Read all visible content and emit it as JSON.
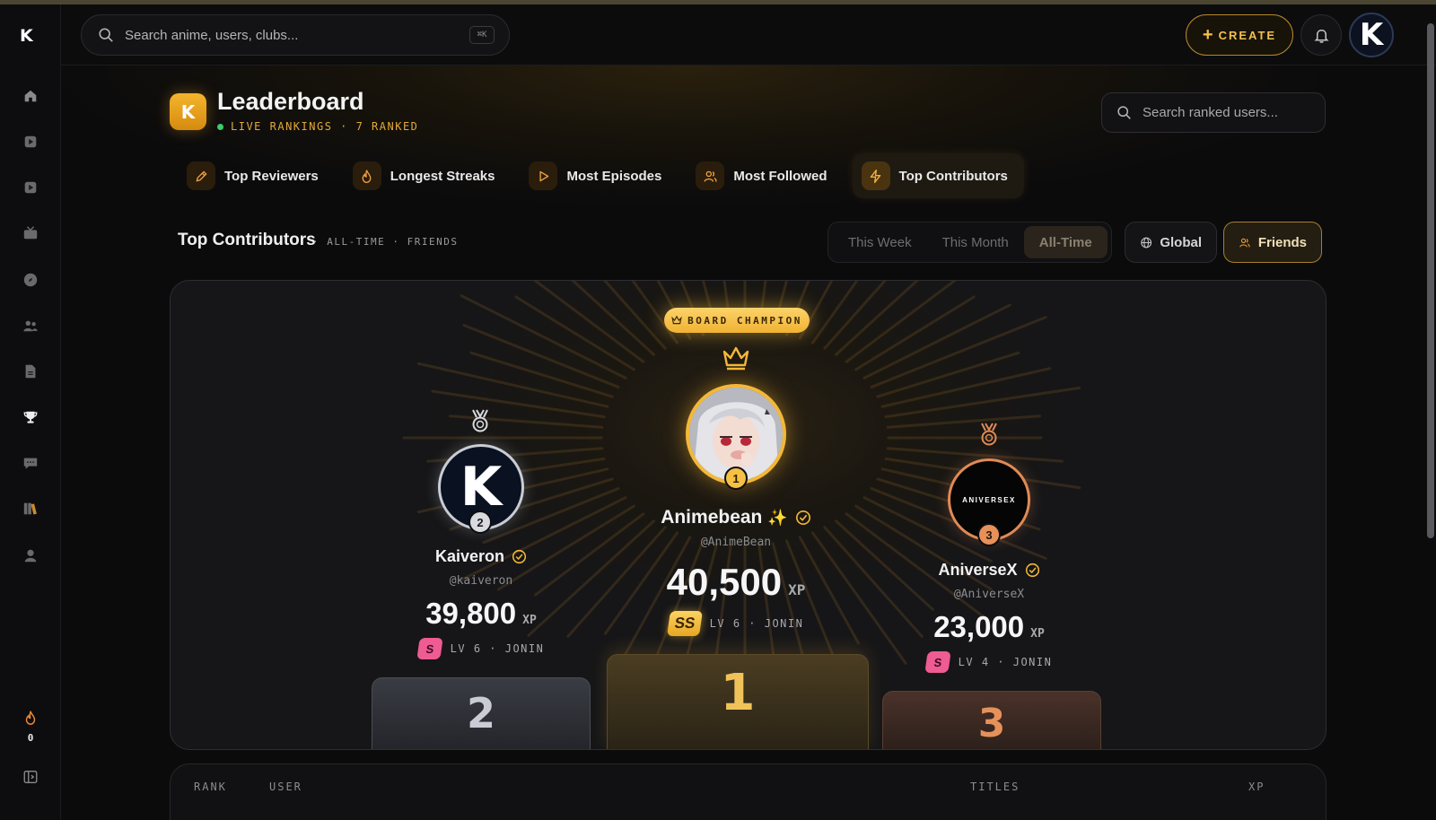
{
  "sidebar": {
    "logo": "K",
    "items": [
      "home-icon",
      "play-icon",
      "video-icon",
      "tv-icon",
      "compass-icon",
      "users-icon",
      "document-icon",
      "trophy-icon",
      "chat-icon",
      "library-icon",
      "profile-icon"
    ],
    "streak_count": "0"
  },
  "header": {
    "search_placeholder": "Search anime, users, clubs...",
    "shortcut": "⌘K",
    "create_label": "CREATE",
    "avatar_letter": "K"
  },
  "page": {
    "title": "Leaderboard",
    "subtitle": "LIVE RANKINGS · 7 RANKED",
    "icon_letter": "K",
    "ranked_search_placeholder": "Search ranked users..."
  },
  "tabs": [
    {
      "label": "Top Reviewers",
      "icon": "pencil-icon"
    },
    {
      "label": "Longest Streaks",
      "icon": "flame-icon"
    },
    {
      "label": "Most Episodes",
      "icon": "play-icon"
    },
    {
      "label": "Most Followed",
      "icon": "users-icon"
    },
    {
      "label": "Top Contributors",
      "icon": "bolt-icon",
      "active": true
    }
  ],
  "section": {
    "title": "Top Contributors",
    "meta": "· ALL-TIME · FRIENDS",
    "periods": [
      "This Week",
      "This Month",
      "All-Time"
    ],
    "active_period": "All-Time",
    "scopes": [
      "Global",
      "Friends"
    ],
    "active_scope": "Friends"
  },
  "podium": {
    "champion_label": "BOARD CHAMPION",
    "first": {
      "rank": "1",
      "name": "Animebean",
      "emoji": "✨",
      "handle": "@AnimeBean",
      "xp": "40,500",
      "xp_unit": "XP",
      "grade": "SS",
      "level": "LV 6 · JONIN",
      "block": "1"
    },
    "second": {
      "rank": "2",
      "name": "Kaiveron",
      "handle": "@kaiveron",
      "xp": "39,800",
      "xp_unit": "XP",
      "grade": "S",
      "level": "LV 6 · JONIN",
      "block": "2",
      "avatar_letter": "K"
    },
    "third": {
      "rank": "3",
      "name": "AniverseX",
      "handle": "@AniverseX",
      "xp": "23,000",
      "xp_unit": "XP",
      "grade": "S",
      "level": "LV 4 · JONIN",
      "block": "3",
      "avatar_text": "ANIVERSEX"
    }
  },
  "table": {
    "columns": [
      "RANK",
      "USER",
      "TITLES",
      "XP"
    ]
  },
  "colors": {
    "accent": "#f5c050",
    "gold": "#f0b232",
    "silver": "#c9ccd4",
    "bronze": "#e08a55",
    "grade_s": "#ef5b93"
  }
}
